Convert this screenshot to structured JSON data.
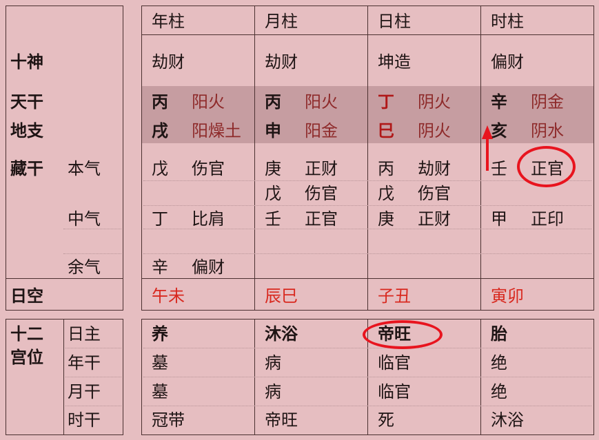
{
  "left_labels": {
    "shishen": "十神",
    "tiangan": "天干",
    "dizhi": "地支",
    "canggan": "藏干",
    "benqi": "本气",
    "zhongqi": "中气",
    "yuqi": "余气",
    "rikong": "日空",
    "shier_gongwei": [
      "十二",
      "宫位"
    ],
    "gongwei_rows": [
      "日主",
      "年干",
      "月干",
      "时干"
    ]
  },
  "pillars": [
    {
      "header": "年柱",
      "shishen": "劫财",
      "stem": "丙",
      "stem_element": "阳火",
      "branch": "戌",
      "branch_element": "阳燥土",
      "hidden": [
        [
          "戊",
          "伤官"
        ],
        null,
        [
          "丁",
          "比肩"
        ],
        null,
        [
          "辛",
          "偏财"
        ]
      ],
      "kong": "午未",
      "gongwei": [
        "养",
        "墓",
        "墓",
        "冠带"
      ]
    },
    {
      "header": "月柱",
      "shishen": "劫财",
      "stem": "丙",
      "stem_element": "阳火",
      "branch": "申",
      "branch_element": "阳金",
      "hidden": [
        [
          "庚",
          "正财"
        ],
        [
          "戊",
          "伤官"
        ],
        [
          "壬",
          "正官"
        ],
        null,
        null
      ],
      "kong": "辰巳",
      "gongwei": [
        "沐浴",
        "病",
        "病",
        "帝旺"
      ]
    },
    {
      "header": "日柱",
      "shishen": "坤造",
      "stem": "丁",
      "stem_element": "阴火",
      "branch": "巳",
      "branch_element": "阴火",
      "hidden": [
        [
          "丙",
          "劫财"
        ],
        [
          "戊",
          "伤官"
        ],
        [
          "庚",
          "正财"
        ],
        null,
        null
      ],
      "kong": "子丑",
      "gongwei": [
        "帝旺",
        "临官",
        "临官",
        "死"
      ]
    },
    {
      "header": "时柱",
      "shishen": "偏财",
      "stem": "辛",
      "stem_element": "阴金",
      "branch": "亥",
      "branch_element": "阴水",
      "hidden": [
        [
          "壬",
          "正官"
        ],
        null,
        [
          "甲",
          "正印"
        ],
        null,
        null
      ],
      "kong": "寅卯",
      "gongwei": [
        "胎",
        "绝",
        "绝",
        "沐浴"
      ]
    }
  ],
  "annotations": {
    "circled": [
      "时柱 本气 正官",
      "日柱 日主 帝旺"
    ],
    "arrow": "up arrow beside 亥",
    "color": "#e8141e"
  },
  "colors": {
    "background": "#e6bec1",
    "band": "#c69da1",
    "element_text": "#8e2a2a",
    "kong_text": "#d8281e"
  }
}
